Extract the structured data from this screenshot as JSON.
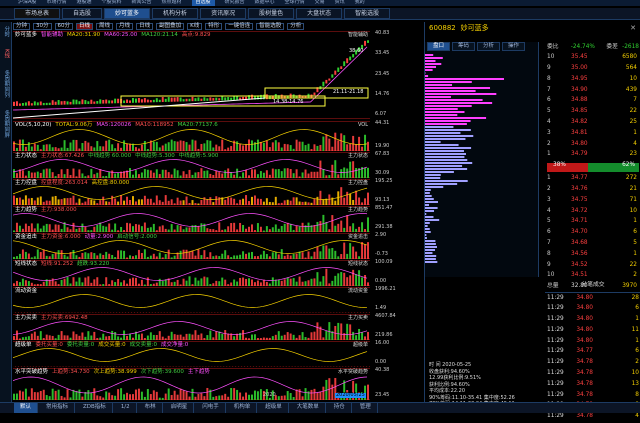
{
  "top_menu": {
    "items": [
      "沪深A股",
      "市场行情",
      "港股通",
      "个股资料",
      "新闻公告",
      "热点题材",
      "自选股",
      "研究报告",
      "数据中心",
      "全球行情",
      "交易",
      "资讯",
      "我的"
    ],
    "selected": "自选股"
  },
  "tabs": [
    {
      "label": "市场总表"
    },
    {
      "label": "自选股"
    },
    {
      "label": "妙可蓝多"
    },
    {
      "label": "机构分析"
    },
    {
      "label": "资讯原况"
    },
    {
      "label": "股树量色"
    },
    {
      "label": "大盘状态"
    },
    {
      "label": "智能选股"
    }
  ],
  "left_sidebar": [
    "分时",
    "K线",
    "多周期同列",
    "多周期同屏"
  ],
  "toolbar": {
    "items": [
      "分钟",
      "30分",
      "60分",
      "日线",
      "周线",
      "月线",
      "日线",
      "副图叠加",
      "K线",
      "特形",
      "一键倍连",
      "智能选股",
      "分析"
    ]
  },
  "stock": {
    "name": "妙可蓝多",
    "code": "600882"
  },
  "panels": [
    {
      "id": "main",
      "title": "妙可蓝多",
      "labels": [
        {
          "c": "m",
          "t": "智能辅助"
        },
        {
          "c": "y",
          "t": "MA20:31.90"
        },
        {
          "c": "m",
          "t": "MA60:25.00"
        },
        {
          "c": "g",
          "t": "MA120:21.14"
        },
        {
          "c": "r",
          "t": "高点:9.829"
        }
      ],
      "tag": "智能辅助"
    },
    {
      "id": "vol",
      "title": "VOL(5,10,20)",
      "labels": [
        {
          "c": "y",
          "t": "TOTAL:9.06万"
        },
        {
          "c": "m",
          "t": "MA5:120026"
        },
        {
          "c": "r",
          "t": "MA10:118952"
        },
        {
          "c": "g",
          "t": "MA20:77137.6"
        }
      ],
      "tag": "VOL"
    },
    {
      "id": "p3",
      "title": "主力状态",
      "labels": [
        {
          "c": "r",
          "t": "主力状态:67.426"
        },
        {
          "c": "g",
          "t": "中线趋势 60.000"
        },
        {
          "c": "g",
          "t": "中线趋势:5.300"
        },
        {
          "c": "g",
          "t": "中线趋势:5.900"
        }
      ],
      "tag": "主力状态"
    },
    {
      "id": "p4",
      "title": "主力控盘",
      "labels": [
        {
          "c": "r",
          "t": "控盘程度:263.014"
        },
        {
          "c": "y",
          "t": "高控盘:80.000"
        }
      ],
      "tag": "主力控盘"
    },
    {
      "id": "p5",
      "title": "主力趋势",
      "labels": [
        {
          "c": "r",
          "t": "主力:938.000"
        }
      ],
      "tag": "主力趋势"
    },
    {
      "id": "p6",
      "title": "资金追击",
      "labels": [
        {
          "c": "r",
          "t": "主力资金:6.000"
        },
        {
          "c": "m",
          "t": "动量:2.900"
        },
        {
          "c": "g",
          "t": "启动信号:2.000"
        }
      ],
      "tag": "资金追击"
    },
    {
      "id": "p7",
      "title": "短线状态",
      "labels": [
        {
          "c": "r",
          "t": "短线:91.252"
        },
        {
          "c": "g",
          "t": "超跌:93.220"
        }
      ],
      "tag": "短线状态"
    },
    {
      "id": "p8",
      "title": "流动资金",
      "labels": [],
      "tag": "流动资金"
    },
    {
      "id": "p9",
      "title": "主力买卖",
      "labels": [
        {
          "c": "r",
          "t": "主力买卖:6942.48"
        }
      ],
      "tag": "主力买卖"
    },
    {
      "id": "p10",
      "title": "超级单",
      "labels": [
        {
          "c": "r",
          "t": "委托买量:0"
        },
        {
          "c": "g",
          "t": "委托卖量:0"
        },
        {
          "c": "y",
          "t": "成交买量:0"
        },
        {
          "c": "g",
          "t": "成交卖量:0"
        },
        {
          "c": "m",
          "t": "成交净量:0"
        }
      ],
      "tag": "超级单"
    },
    {
      "id": "p11",
      "title": "水平突破趋势",
      "labels": [
        {
          "c": "r",
          "t": "上趋势:34.730"
        },
        {
          "c": "y",
          "t": "次上趋势:38.999"
        },
        {
          "c": "g",
          "t": "次下趋势:39.600"
        },
        {
          "c": "m",
          "t": "主下趋势"
        }
      ],
      "tag": "水平突破趋势"
    }
  ],
  "axes": {
    "main": [
      "40.83",
      "33.45",
      "23.45",
      "14.76",
      "6.07"
    ],
    "vol": [
      "44.31",
      "19.90"
    ],
    "p3": [
      "67.83",
      "30.09"
    ],
    "p4": [
      "195.25",
      "93.13"
    ],
    "p5": [
      "851.47",
      "291.38"
    ],
    "p6": [
      "2.90",
      "-0.73"
    ],
    "p7": [
      "100.09",
      "0.00"
    ],
    "p8": [
      "1996.21",
      "1.49"
    ],
    "p9": [
      "4607.84",
      "219.86"
    ],
    "p10": [
      "16.00",
      "0.00"
    ],
    "p11": [
      "40.38",
      "23.45"
    ]
  },
  "annotations": {
    "high": "38.60",
    "mid": "21.11-21.18",
    "low": "14.38-14.76"
  },
  "date_label": "2020",
  "cursor_date": "2020/05/25",
  "right": {
    "tabs": [
      "盘口",
      "筹码",
      "分析",
      "操作"
    ],
    "header": {
      "weibi_label": "委比",
      "weibi_val": "-24.74%",
      "weicha_label": "委差",
      "weicha_val": "-2618"
    },
    "sell": [
      {
        "lvl": "10",
        "price": "35.45",
        "vol": "6580"
      },
      {
        "lvl": "9",
        "price": "35.00",
        "vol": "564"
      },
      {
        "lvl": "8",
        "price": "34.95",
        "vol": "10"
      },
      {
        "lvl": "7",
        "price": "34.90",
        "vol": "439"
      },
      {
        "lvl": "6",
        "price": "34.88",
        "vol": "7"
      },
      {
        "lvl": "5",
        "price": "34.85",
        "vol": "22"
      },
      {
        "lvl": "4",
        "price": "34.82",
        "vol": "25"
      },
      {
        "lvl": "3",
        "price": "34.81",
        "vol": "1"
      },
      {
        "lvl": "2",
        "price": "34.80",
        "vol": "4"
      },
      {
        "lvl": "1",
        "price": "34.79",
        "vol": "23"
      }
    ],
    "wb_left": "38%",
    "wb_right": "62%",
    "buy": [
      {
        "lvl": "1",
        "price": "34.77",
        "vol": "272"
      },
      {
        "lvl": "2",
        "price": "34.76",
        "vol": "21"
      },
      {
        "lvl": "3",
        "price": "34.75",
        "vol": "71"
      },
      {
        "lvl": "4",
        "price": "34.72",
        "vol": "10"
      },
      {
        "lvl": "5",
        "price": "34.71",
        "vol": "1"
      },
      {
        "lvl": "6",
        "price": "34.70",
        "vol": "6"
      },
      {
        "lvl": "7",
        "price": "34.68",
        "vol": "5"
      },
      {
        "lvl": "8",
        "price": "34.56",
        "vol": "1"
      },
      {
        "lvl": "9",
        "price": "34.52",
        "vol": "22"
      },
      {
        "lvl": "10",
        "price": "34.51",
        "vol": "2"
      }
    ],
    "buy_total_label": "总量",
    "buy_total_a": "32.80",
    "buy_total_b": "3970",
    "trades_title": "分笔成交",
    "trades": [
      {
        "t": "11:29",
        "p": "34.80",
        "v": "28"
      },
      {
        "t": "11:29",
        "p": "34.80",
        "v": "6"
      },
      {
        "t": "11:29",
        "p": "34.80",
        "v": "1"
      },
      {
        "t": "11:29",
        "p": "34.80",
        "v": "11"
      },
      {
        "t": "11:29",
        "p": "34.80",
        "v": "1"
      },
      {
        "t": "11:29",
        "p": "34.77",
        "v": "6"
      },
      {
        "t": "11:29",
        "p": "34.78",
        "v": "2"
      },
      {
        "t": "11:29",
        "p": "34.78",
        "v": "10"
      },
      {
        "t": "11:29",
        "p": "34.78",
        "v": "13"
      },
      {
        "t": "11:29",
        "p": "34.78",
        "v": "8"
      },
      {
        "t": "11:29",
        "p": "34.78",
        "v": "8"
      },
      {
        "t": "11:29",
        "p": "34.78",
        "v": "4"
      }
    ],
    "chip_info": [
      "时 间 2020-05-25",
      "收盘获利:94.60%",
      "12.99获利比例:9.51%",
      "获利比例:94.60%",
      "平均成本:22.20",
      "90%筹码:11.10-35.41 集中度:52.26",
      "70%筹码:14.11-33.04 集中度:40.11",
      "筹码分布:59.13"
    ],
    "bottom_tabs": [
      "逐笔成交",
      "逐笔成交",
      "筹码",
      "明细",
      "分价",
      "分笔",
      "分时"
    ]
  },
  "bottom_tabs": [
    "默认",
    "常用指标",
    "ZDB指标",
    "1/2",
    "布林",
    "启明星",
    "闪电手",
    "机构单",
    "超级单",
    "大笔数单",
    "持仓",
    "管理"
  ],
  "colors": {
    "up": "#ff4040",
    "down": "#30d030",
    "accent": "#1f4f8f",
    "yellow": "#f5d000"
  }
}
